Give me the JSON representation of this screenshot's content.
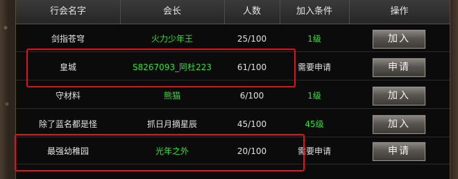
{
  "header": {
    "col_name": "行会名字",
    "col_leader": "会长",
    "col_count": "人数",
    "col_condition": "加入条件",
    "col_action": "操作"
  },
  "rows": [
    {
      "name": "剑指苍穹",
      "leader": "火力少年王",
      "count": "25/100",
      "condition": "1级",
      "action": "加入"
    },
    {
      "name": "皇城",
      "leader": "S8267093_阿杜223",
      "count": "61/100",
      "condition": "需要申请",
      "action": "申请"
    },
    {
      "name": "守材料",
      "leader": "熊猫",
      "count": "6/100",
      "condition": "1级",
      "action": "加入"
    },
    {
      "name": "除了蓝名都是怪",
      "leader": "抓日月摘星辰",
      "count": "45/100",
      "condition": "45级",
      "action": "加入"
    },
    {
      "name": "最强幼稚园",
      "leader": "光年之外",
      "count": "20/100",
      "condition": "需要申请",
      "action": "申请"
    }
  ],
  "colors": {
    "green_text": "#2fe22f",
    "highlight_red": "#e0121a"
  }
}
